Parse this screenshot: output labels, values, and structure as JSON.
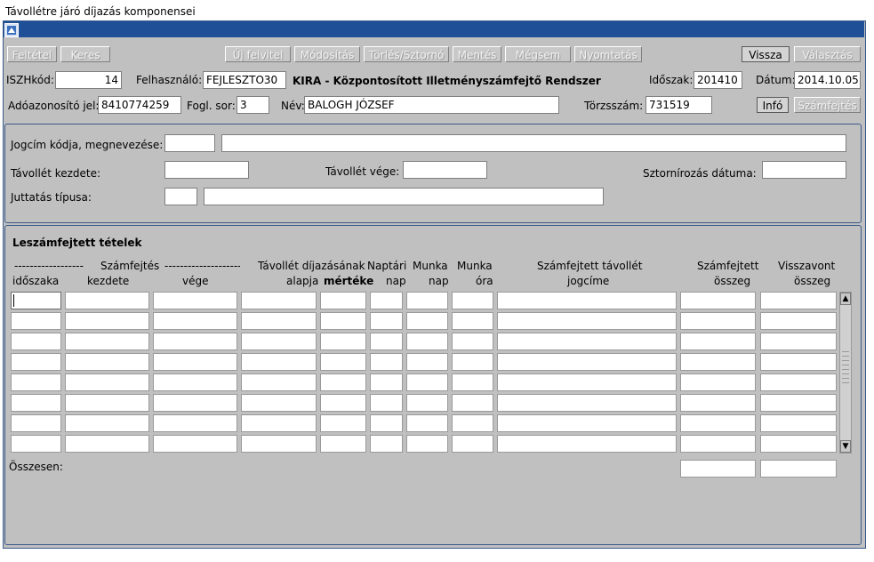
{
  "window": {
    "title": "Távollétre járó díjazás komponensei"
  },
  "toolbar": {
    "feltetel": "Feltétel",
    "keres": "Keres",
    "uj_felvitel": "Új felvitel",
    "modositas": "Módosítás",
    "torles": "Törlés/Sztornó",
    "mentes": "Mentés",
    "megsem": "Mégsem",
    "nyomtatas": "Nyomtatás",
    "vissza": "Vissza",
    "valasztas": "Választás"
  },
  "header": {
    "iszhkod_label": "ISZHkód:",
    "iszhkod_value": "14",
    "felhasznalo_label": "Felhasználó:",
    "felhasznalo_value": "FEJLESZTO30",
    "system_title": "KIRA - Központosított Illetményszámfejtő Rendszer",
    "idoszak_label": "Időszak:",
    "idoszak_value": "201410",
    "datum_label": "Dátum:",
    "datum_value": "2014.10.05.",
    "adoazonosito_label": "Adóazonosító jel:",
    "adoazonosito_value": "8410774259",
    "fogl_sor_label": "Fogl. sor:",
    "fogl_sor_value": "3",
    "nev_label": "Név:",
    "nev_value": "BALOGH JÓZSEF",
    "torzsszam_label": "Törzsszám:",
    "torzsszam_value": "731519",
    "info_button": "Infó",
    "szamfejtes_button": "Számfejtés"
  },
  "form": {
    "jogcim_label": "Jogcím kódja, megnevezése:",
    "jogcim_kod": "",
    "jogcim_nev": "",
    "tavollet_kezdete_label": "Távollét kezdete:",
    "tavollet_kezdete": "",
    "tavollet_vege_label": "Távollét vége:",
    "tavollet_vege": "",
    "sztorno_datum_label": "Sztornírozás dátuma:",
    "sztorno_datum": "",
    "juttatas_label": "Juttatás típusa:",
    "juttatas_kod": "",
    "juttatas_nev": ""
  },
  "table": {
    "title": "Leszámfejtett tételek",
    "group_left_dash": "------------------",
    "group_label": "Számfejtés",
    "group_right_dash": "--------------------",
    "col_idoszaka": "időszaka",
    "col_kezdete": "kezdete",
    "col_vege": "vége",
    "col_tavollet_top": "Távollét díjazásának",
    "col_alapja": "alapja",
    "col_merteke": "mértéke",
    "col_naptari_top": "Naptári",
    "col_naptari_bottom": "nap",
    "col_munkanap_top": "Munka",
    "col_munkanap_bottom": "nap",
    "col_munkaora_top": "Munka",
    "col_munkaora_bottom": "óra",
    "col_jogcim_top": "Számfejtett távollét",
    "col_jogcim_bottom": "jogcíme",
    "col_osszeg_top": "Számfejtett",
    "col_osszeg_bottom": "összeg",
    "col_visszavont_top": "Visszavont",
    "col_visszavont_bottom": "összeg",
    "total_label": "Összesen:",
    "total_szamfejtett": "",
    "total_visszavont": ""
  }
}
